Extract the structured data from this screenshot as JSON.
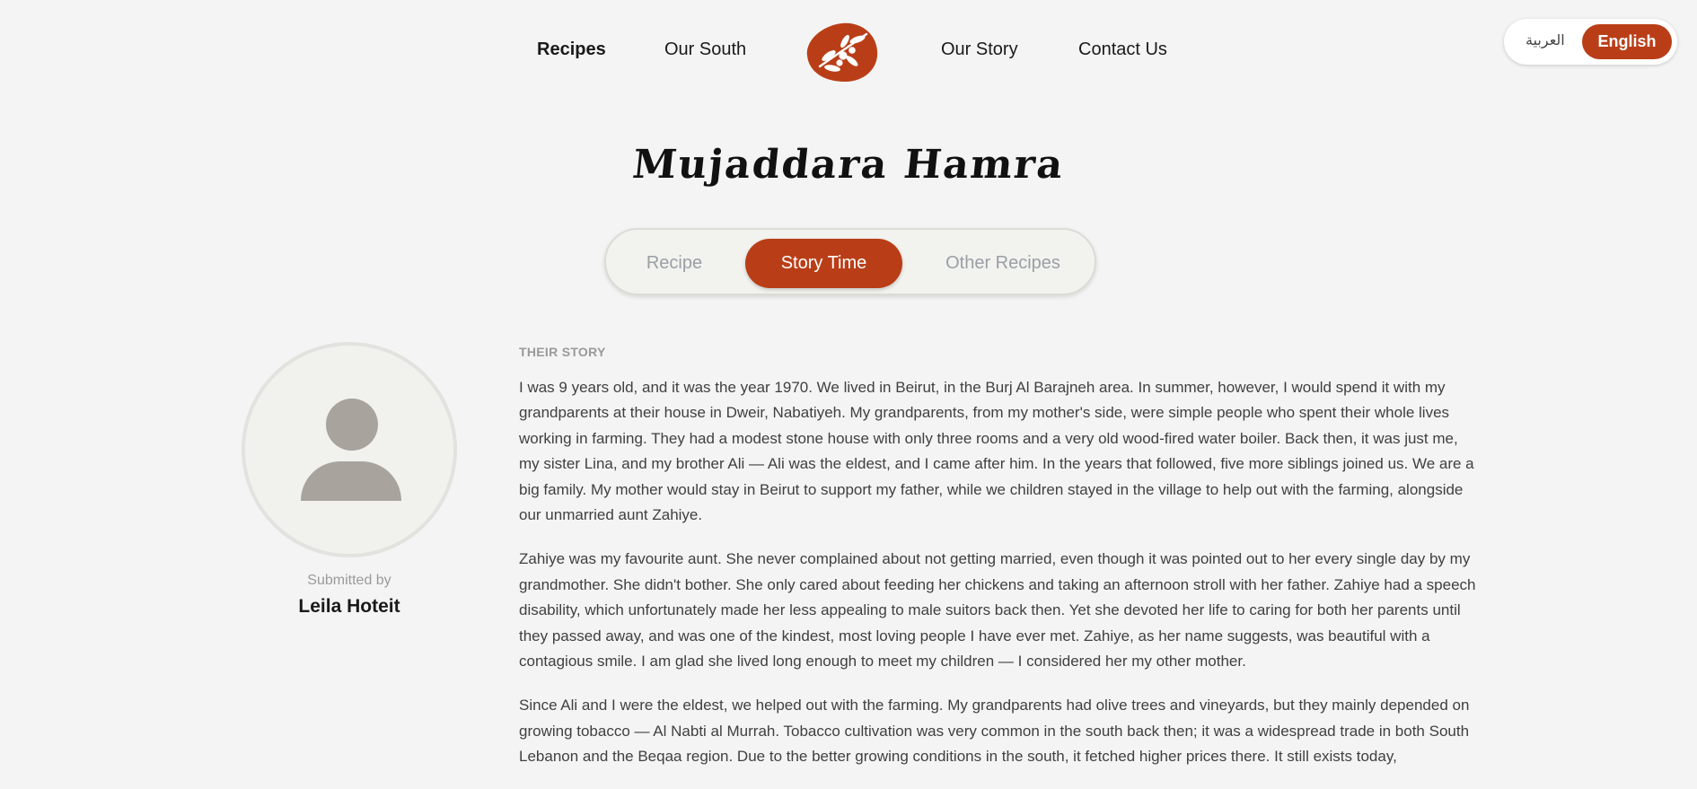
{
  "nav": {
    "recipes": "Recipes",
    "our_south": "Our South",
    "our_story": "Our Story",
    "contact_us": "Contact Us",
    "logo_icon": "olive-branch-icon",
    "brand_color": "#b93e17"
  },
  "language": {
    "arabic": "العربية",
    "english": "English",
    "selected": "English"
  },
  "recipe": {
    "title": "Mujaddara Hamra"
  },
  "tabs": [
    {
      "label": "Recipe",
      "active": false
    },
    {
      "label": "Story Time",
      "active": true
    },
    {
      "label": "Other Recipes",
      "active": false
    }
  ],
  "author": {
    "avatar_icon": "user-avatar-icon",
    "submitted_label": "Submitted by",
    "name": "Leila Hoteit"
  },
  "story": {
    "heading": "THEIR STORY",
    "paragraphs": [
      "I was 9 years old, and it was the year 1970. We lived in Beirut, in the Burj Al Barajneh area. In summer, however, I would spend it with my grandparents at their house in Dweir, Nabatiyeh. My grandparents, from my mother's side, were simple people who spent their whole lives working in farming. They had a modest stone house with only three rooms and a very old wood-fired water boiler. Back then, it was just me, my sister Lina, and my brother Ali — Ali was the eldest, and I came after him. In the years that followed, five more siblings joined us. We are a big family. My mother would stay in Beirut to support my father, while we children stayed in the village to help out with the farming, alongside our unmarried aunt Zahiye.",
      "Zahiye was my favourite aunt. She never complained about not getting married, even though it was pointed out to her every single day by my grandmother. She didn't bother. She only cared about feeding her chickens and taking an afternoon stroll with her father. Zahiye had a speech disability, which unfortunately made her less appealing to male suitors back then. Yet she devoted her life to caring for both her parents until they passed away, and was one of the kindest, most loving people I have ever met. Zahiye, as her name suggests, was beautiful with a contagious smile. I am glad she lived long enough to meet my children — I considered her my other mother.",
      "Since Ali and I were the eldest, we helped out with the farming. My grandparents had olive trees and vineyards, but they mainly depended on growing tobacco — Al Nabti al Murrah. Tobacco cultivation was very common in the south back then; it was a widespread trade in both South Lebanon and the Beqaa region. Due to the better growing conditions in the south, it fetched higher prices there. It still exists today,"
    ]
  }
}
